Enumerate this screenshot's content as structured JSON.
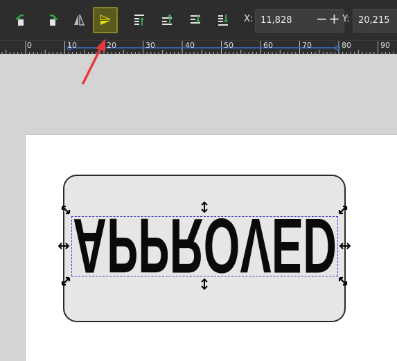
{
  "toolbar": {
    "buttons": [
      {
        "name": "rotate-ccw-button",
        "icon": "rotate-90-ccw-icon"
      },
      {
        "name": "rotate-cw-button",
        "icon": "rotate-90-cw-icon"
      },
      {
        "name": "flip-horizontal-button",
        "icon": "flip-horizontal-icon"
      },
      {
        "name": "flip-vertical-button",
        "icon": "flip-vertical-icon",
        "active": true
      },
      {
        "name": "raise-to-top-button",
        "icon": "raise-to-top-icon"
      },
      {
        "name": "raise-button",
        "icon": "raise-icon"
      },
      {
        "name": "lower-button",
        "icon": "lower-icon"
      },
      {
        "name": "lower-to-bottom-button",
        "icon": "lower-to-bottom-icon"
      }
    ],
    "x_label": "X:",
    "x_value": "11,828",
    "minus": "−",
    "plus": "+",
    "y_label": "Y:",
    "y_value": "20,215"
  },
  "ruler": {
    "labels": [
      "0",
      "10",
      "20",
      "30",
      "40",
      "50",
      "60",
      "70",
      "80",
      "90"
    ]
  },
  "canvas": {
    "sign_text": "APPROVED",
    "text_flipped": true
  },
  "colors": {
    "toolbar_bg": "#2d2d2d",
    "active_button": "#5b5a1e",
    "icon_green": "#3aa64a",
    "selection": "#3a3ad0",
    "annotation_arrow": "#e8383b"
  }
}
